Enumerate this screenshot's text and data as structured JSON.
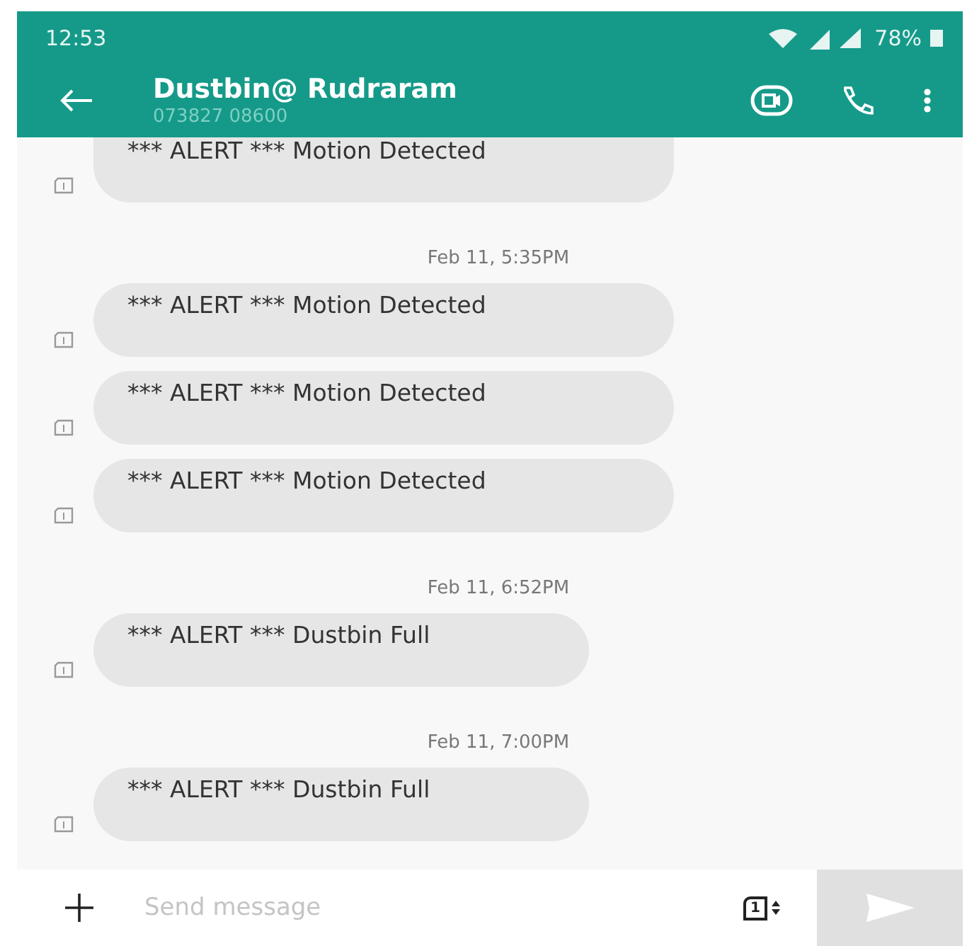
{
  "status_bar": {
    "time": "12:53",
    "battery": "78%"
  },
  "header": {
    "title": "Dustbin@ Rudraram",
    "subtitle": "073827 08600"
  },
  "conversation": [
    {
      "kind": "message",
      "text": "*** ALERT *** Motion Detected"
    },
    {
      "kind": "timestamp",
      "text": "Feb 11, 5:35PM"
    },
    {
      "kind": "message",
      "text": "*** ALERT *** Motion Detected"
    },
    {
      "kind": "message",
      "text": "*** ALERT *** Motion Detected"
    },
    {
      "kind": "message",
      "text": "*** ALERT *** Motion Detected"
    },
    {
      "kind": "timestamp",
      "text": "Feb 11, 6:52PM"
    },
    {
      "kind": "message",
      "text": "*** ALERT *** Dustbin Full"
    },
    {
      "kind": "timestamp",
      "text": "Feb 11, 7:00PM"
    },
    {
      "kind": "message",
      "text": "*** ALERT *** Dustbin Full"
    }
  ],
  "composer": {
    "placeholder": "Send message",
    "sim_slot": "1"
  }
}
